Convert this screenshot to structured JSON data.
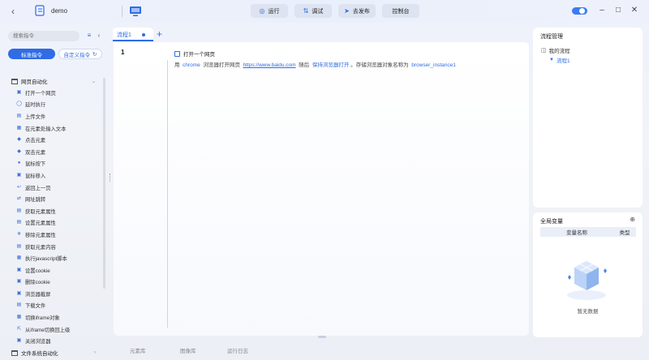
{
  "titlebar": {
    "project_name": "demo",
    "buttons": [
      {
        "label": "运行",
        "icon": "run-icon"
      },
      {
        "label": "调试",
        "icon": "debug-icon"
      },
      {
        "label": "去发布",
        "icon": "publish-icon"
      },
      {
        "label": "控制台",
        "icon": ""
      }
    ]
  },
  "sidebar": {
    "search_placeholder": "搜索指令",
    "segments": {
      "standard": "标准指令",
      "custom": "自定义指令"
    },
    "group": "网页自动化",
    "commands": [
      "打开一个网页",
      "延时执行",
      "上传文件",
      "在元素处输入文本",
      "点击元素",
      "双击元素",
      "鼠标按下",
      "鼠标移入",
      "返回上一页",
      "网址跳转",
      "获取元素属性",
      "设置元素属性",
      "移除元素属性",
      "获取元素内容",
      "执行javascript脚本",
      "设置cookie",
      "删除cookie",
      "浏览器截屏",
      "下载文件",
      "切换iframe对象",
      "从iframe切换回上级",
      "关闭浏览器"
    ],
    "group2": "文件系统自动化"
  },
  "editor": {
    "tab_label": "流程1",
    "line_number": "1",
    "step_title": "打开一个网页",
    "step": {
      "prefix": "用",
      "browser": "chrome",
      "mid": "浏览器打开网页",
      "url": "https://www.baidu.com",
      "then": "随后",
      "action": "保持浏览器打开",
      "store": "。存储浏览器对象名称为",
      "var": "browser_instance1"
    }
  },
  "bottom_tabs": [
    "元素库",
    "图像库",
    "运行日志"
  ],
  "flow_panel": {
    "title": "流程管理",
    "root": "我的流程",
    "child": "流程1"
  },
  "var_panel": {
    "title": "全局变量",
    "col_name": "变量名称",
    "col_type": "类型",
    "empty": "暂无数据"
  },
  "colors": {
    "accent": "#2f6ce6"
  }
}
